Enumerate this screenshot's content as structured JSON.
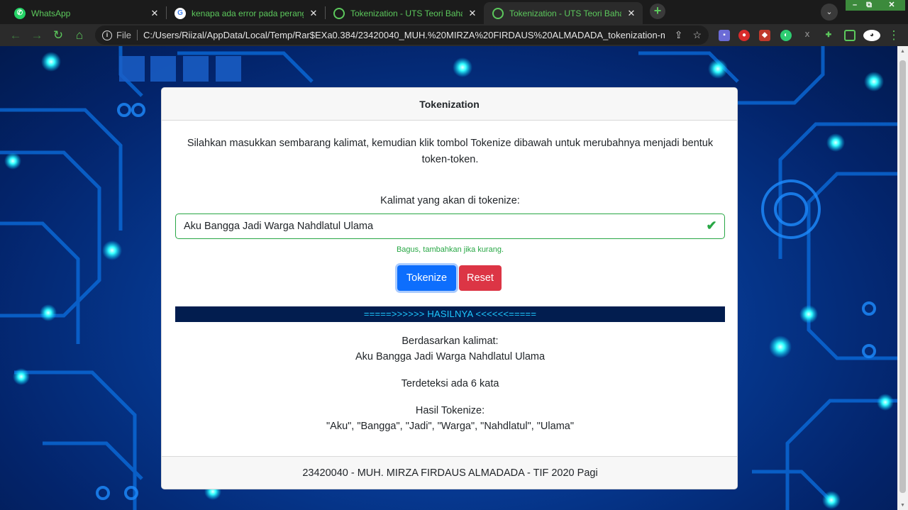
{
  "browser": {
    "tabs": [
      {
        "title": "WhatsApp",
        "icon": "whatsapp-icon"
      },
      {
        "title": "kenapa ada error pada perangkat",
        "icon": "google-icon"
      },
      {
        "title": "Tokenization - UTS Teori Bahasa dan",
        "icon": "globe-icon"
      },
      {
        "title": "Tokenization - UTS Teori Bahasa dan",
        "icon": "globe-icon"
      }
    ],
    "omnibox": {
      "scheme": "File",
      "url": "C:/Users/Riizal/AppData/Local/Temp/Rar$EXa0.384/23420040_MUH.%20MIRZA%20FIRDAUS%20ALMADADA_tokenization-m..."
    },
    "accent_color": "#5cc85c"
  },
  "card": {
    "header": "Tokenization",
    "intro": "Silahkan masukkan sembarang kalimat, kemudian klik tombol Tokenize dibawah untuk merubahnya menjadi bentuk token-token.",
    "input_label": "Kalimat yang akan di tokenize:",
    "input_value": "Aku Bangga Jadi Warga Nahdlatul Ulama",
    "valid_feedback": "Bagus, tambahkan jika kurang.",
    "buttons": {
      "tokenize": "Tokenize",
      "reset": "Reset"
    },
    "result_header": "=====>>>>>> HASILNYA <<<<<<=====",
    "result": {
      "based_on_label": "Berdasarkan kalimat:",
      "sentence": "Aku Bangga Jadi Warga Nahdlatul Ulama",
      "count_text": "Terdeteksi ada 6 kata",
      "tokens_label": "Hasil Tokenize:",
      "tokens": "\"Aku\", \"Bangga\", \"Jadi\", \"Warga\", \"Nahdlatul\", \"Ulama\""
    },
    "footer": "23420040 - MUH. MIRZA FIRDAUS ALMADADA - TIF 2020 Pagi"
  },
  "colors": {
    "primary": "#0d6efd",
    "danger": "#dc3545",
    "success": "#28a745",
    "result_bar": "#021d4f",
    "result_text": "#1ec8ff"
  }
}
